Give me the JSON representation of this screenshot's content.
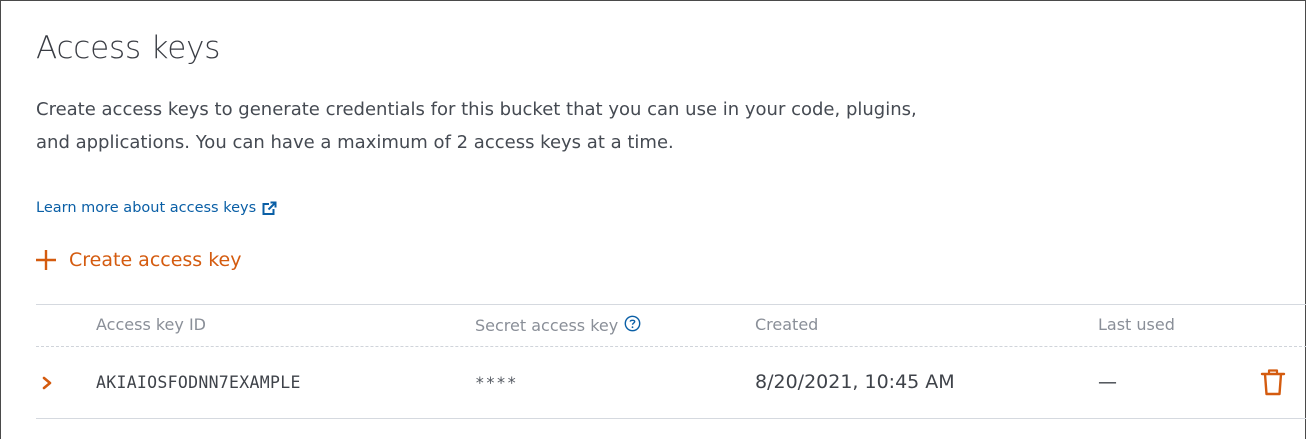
{
  "section": {
    "title": "Access keys",
    "description": "Create access keys to generate credentials for this bucket that you can use in your code, plugins, and applications. You can have a maximum of 2 access keys at a time.",
    "learn_more_label": "Learn more about access keys",
    "create_label": "Create access key"
  },
  "table": {
    "headers": {
      "access_key_id": "Access key ID",
      "secret_access_key": "Secret access key",
      "created": "Created",
      "last_used": "Last used"
    },
    "rows": [
      {
        "access_key_id": "AKIAIOSFODNN7EXAMPLE",
        "secret_access_key": "****",
        "created": "8/20/2021, 10:45 AM",
        "last_used": "—"
      }
    ]
  },
  "icons": {
    "external_link": "external-link-icon",
    "plus": "plus-icon",
    "help": "help-icon",
    "chevron": "chevron-right-icon",
    "delete": "trash-icon"
  },
  "colors": {
    "link": "#0a5fa6",
    "accent": "#d45b0f",
    "text": "#424650",
    "muted": "#8a8f98"
  }
}
